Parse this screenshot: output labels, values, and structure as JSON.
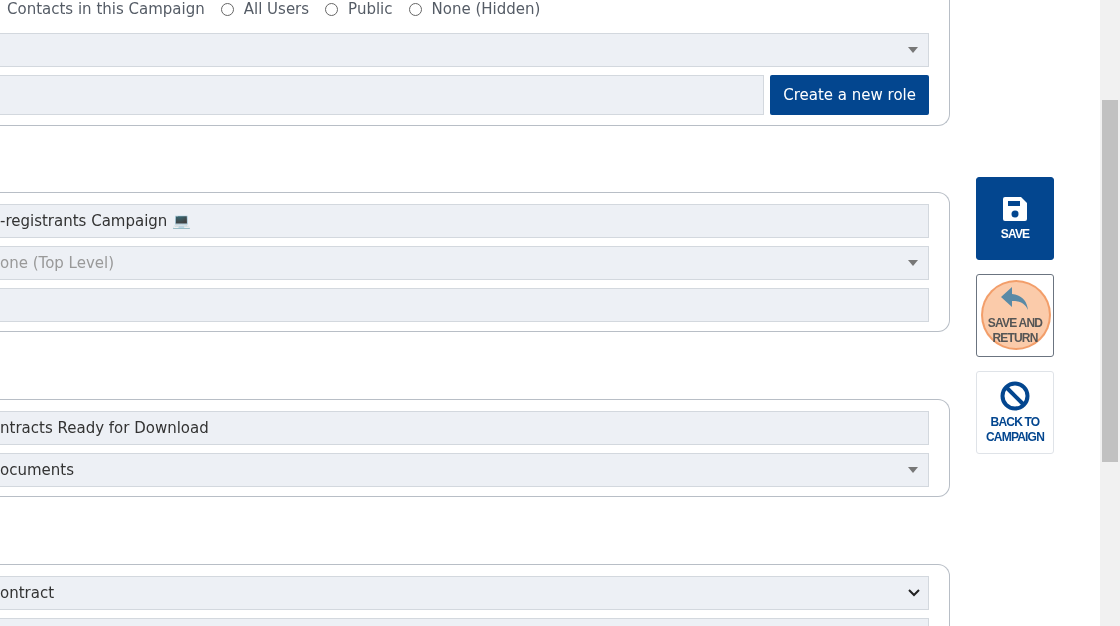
{
  "visibility": {
    "cut_label": "Contacts in this Campaign",
    "options": [
      {
        "label": "All Users",
        "selected": false
      },
      {
        "label": "Public",
        "selected": false
      },
      {
        "label": "None (Hidden)",
        "selected": false
      }
    ]
  },
  "role_fields": {
    "create_button": "Create a new role"
  },
  "cards": [
    {
      "fields": [
        {
          "kind": "input",
          "value": "-registrants Campaign 💻"
        },
        {
          "kind": "select",
          "placeholder": "one (Top Level)"
        },
        {
          "kind": "input"
        }
      ]
    },
    {
      "fields": [
        {
          "kind": "input",
          "value": "ntracts Ready for Download"
        },
        {
          "kind": "select",
          "value": "ocuments"
        }
      ]
    },
    {
      "fields": [
        {
          "kind": "dropdown",
          "value": "ontract"
        },
        {
          "kind": "tags"
        }
      ]
    }
  ],
  "actions": [
    {
      "kind": "save",
      "label": "SAVE",
      "highlighted": false
    },
    {
      "kind": "save-return",
      "label": "SAVE AND RETURN",
      "highlighted": true
    },
    {
      "kind": "back",
      "label": "BACK TO CAMPAIGN",
      "highlighted": false
    }
  ]
}
